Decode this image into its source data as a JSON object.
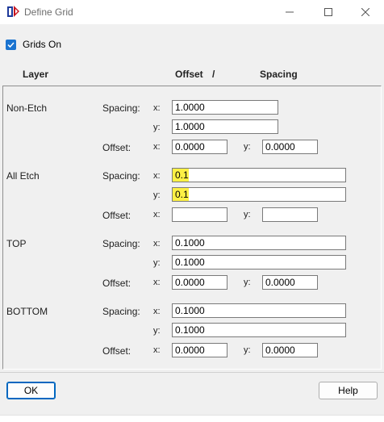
{
  "window": {
    "title": "Define Grid"
  },
  "grids_on": {
    "label": "Grids On",
    "checked": true
  },
  "headers": {
    "layer": "Layer",
    "offset": "Offset",
    "slash": "/",
    "spacing": "Spacing"
  },
  "labels": {
    "spacing": "Spacing:",
    "offset": "Offset:",
    "x": "x:",
    "y": "y:"
  },
  "layers": [
    {
      "name": "Non-Etch",
      "spacing_x": "1.0000",
      "spacing_y": "1.0000",
      "offset_x": "0.0000",
      "offset_y": "0.0000"
    },
    {
      "name": "All Etch",
      "spacing_x": "0.1",
      "spacing_y": "0.1",
      "offset_x": "",
      "offset_y": ""
    },
    {
      "name": "TOP",
      "spacing_x": "0.1000",
      "spacing_y": "0.1000",
      "offset_x": "0.0000",
      "offset_y": "0.0000"
    },
    {
      "name": "BOTTOM",
      "spacing_x": "0.1000",
      "spacing_y": "0.1000",
      "offset_x": "0.0000",
      "offset_y": "0.0000"
    }
  ],
  "buttons": {
    "ok": "OK",
    "help": "Help"
  },
  "colors": {
    "highlight": "#fdf145",
    "checkbox": "#1a73d0",
    "default_button_border": "#0067c0"
  },
  "icons": {
    "app": "define-grid-app-icon",
    "minimize": "minimize-icon",
    "maximize": "maximize-icon",
    "close": "close-icon",
    "check": "checkmark-icon"
  }
}
